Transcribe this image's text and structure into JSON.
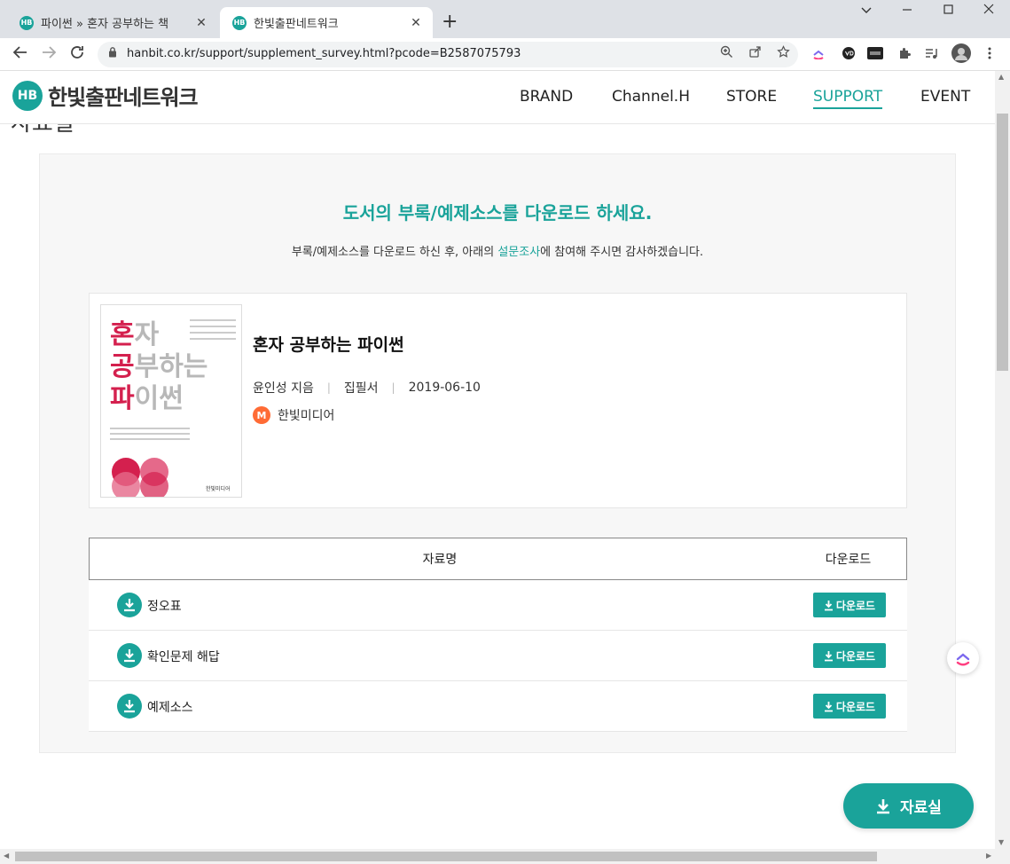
{
  "browser": {
    "tabs": [
      {
        "title": "파이썬 » 혼자 공부하는 책",
        "favicon": "HB"
      },
      {
        "title": "한빛출판네트워크",
        "favicon": "HB"
      }
    ],
    "close_glyph": "✕",
    "new_tab_glyph": "+",
    "url": "hanbit.co.kr/support/supplement_survey.html?pcode=B2587075793"
  },
  "site": {
    "logo_mark": "HB",
    "logo_text": "한빛출판네트워크",
    "nav": [
      "BRAND",
      "Channel.H",
      "STORE",
      "SUPPORT",
      "EVENT"
    ],
    "active_nav": "SUPPORT",
    "page_title": "자료실"
  },
  "main": {
    "headline": "도서의 부록/예제소스를 다운로드 하세요.",
    "sub_before": "부록/예제소스를 다운로드 하신 후, 아래의 ",
    "sub_link": "설문조사",
    "sub_after": "에 참여해 주시면 감사하겠습니다."
  },
  "book": {
    "title": "혼자 공부하는 파이썬",
    "author": "윤인성 지음",
    "category": "집필서",
    "date": "2019-06-10",
    "publisher_badge": "M",
    "publisher": "한빛미디어",
    "cover": {
      "line1_red": "혼",
      "line1_grey": "자",
      "line2_red": "공",
      "line2_grey": "부하는",
      "line3_red": "파",
      "line3_grey": "이썬",
      "publisher": "한빛미디어"
    }
  },
  "table": {
    "col_name": "자료명",
    "col_download": "다운로드",
    "rows": [
      {
        "name": "정오표",
        "button": "다운로드"
      },
      {
        "name": "확인문제 해답",
        "button": "다운로드"
      },
      {
        "name": "예제소스",
        "button": "다운로드"
      }
    ]
  },
  "fab": {
    "label": "자료실"
  },
  "colors": {
    "accent": "#1aa39a",
    "cover_red": "#d4204e",
    "publisher_badge": "#ff6b35"
  }
}
